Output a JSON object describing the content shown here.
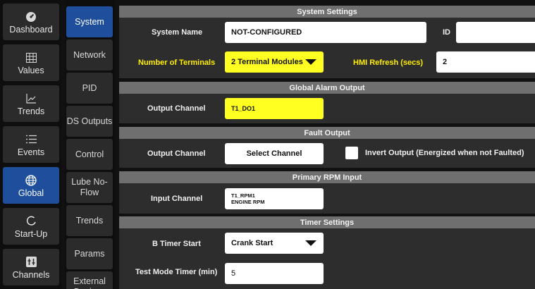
{
  "nav": {
    "items": [
      {
        "label": "Dashboard",
        "icon": "gauge-icon"
      },
      {
        "label": "Values",
        "icon": "grid-icon"
      },
      {
        "label": "Trends",
        "icon": "line-chart-icon"
      },
      {
        "label": "Events",
        "icon": "list-icon"
      },
      {
        "label": "Global",
        "icon": "globe-icon",
        "active": true
      },
      {
        "label": "Start-Up",
        "icon": "refresh-icon"
      },
      {
        "label": "Channels",
        "icon": "io-icon"
      }
    ]
  },
  "subnav": {
    "items": [
      "System",
      "Network",
      "PID",
      "DS Outputs",
      "Control",
      "Lube No-Flow",
      "Trends",
      "Params",
      "External Devices"
    ]
  },
  "system_settings": {
    "header": "System Settings",
    "system_name_label": "System Name",
    "system_name_value": "NOT-CONFIGURED",
    "id_label": "ID",
    "id_value": "",
    "terminals_label": "Number of Terminals",
    "terminals_value": "2 Terminal Modules",
    "hmi_label": "HMI Refresh (secs)",
    "hmi_value": "2"
  },
  "global_alarm": {
    "header": "Global Alarm Output",
    "channel_label": "Output Channel",
    "channel_value": "T1_DO1"
  },
  "fault_output": {
    "header": "Fault Output",
    "channel_label": "Output Channel",
    "channel_button": "Select Channel",
    "invert_label": "Invert Output (Energized when not Faulted)"
  },
  "rpm_input": {
    "header": "Primary RPM Input",
    "channel_label": "Input Channel",
    "channel_line1": "T1_RPM1",
    "channel_line2": "ENGINE RPM"
  },
  "timer_settings": {
    "header": "Timer Settings",
    "b_timer_label": "B Timer Start",
    "b_timer_value": "Crank Start",
    "test_mode_label": "Test Mode Timer (min)",
    "test_mode_value": "5"
  },
  "colors": {
    "active_blue": "#1f4f9c",
    "highlight_yellow": "#ffff22",
    "label_yellow": "#ffee00"
  }
}
